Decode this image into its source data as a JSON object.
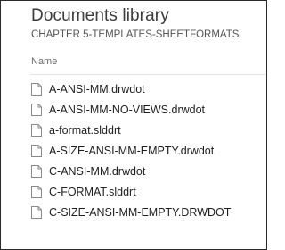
{
  "library": {
    "title": "Documents library",
    "subtitle": "CHAPTER 5-TEMPLATES-SHEETFORMATS"
  },
  "columns": {
    "name_label": "Name"
  },
  "files": [
    {
      "name": "A-ANSI-MM.drwdot",
      "icon": "document-icon"
    },
    {
      "name": "A-ANSI-MM-NO-VIEWS.drwdot",
      "icon": "document-icon"
    },
    {
      "name": "a-format.slddrt",
      "icon": "document-icon"
    },
    {
      "name": "A-SIZE-ANSI-MM-EMPTY.drwdot",
      "icon": "document-icon"
    },
    {
      "name": "C-ANSI-MM.drwdot",
      "icon": "document-icon"
    },
    {
      "name": "C-FORMAT.slddrt",
      "icon": "document-icon"
    },
    {
      "name": "C-SIZE-ANSI-MM-EMPTY.DRWDOT",
      "icon": "document-icon"
    }
  ]
}
